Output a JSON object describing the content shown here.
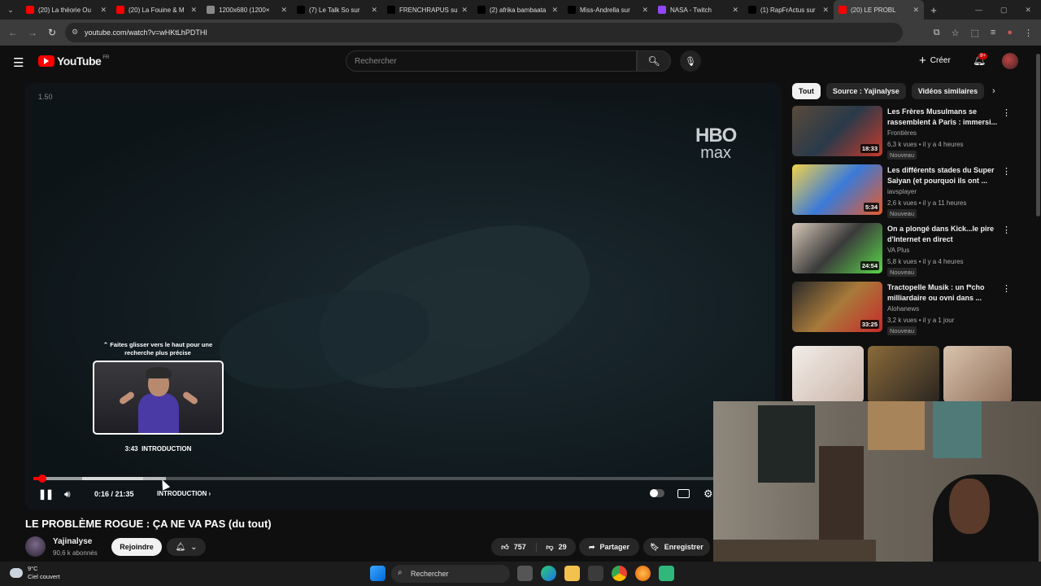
{
  "browser": {
    "tabs": [
      {
        "label": "(20) La théorie Ou",
        "color": "#ff0000"
      },
      {
        "label": "(20) La Fouine & M",
        "color": "#ff0000"
      },
      {
        "label": "1200x680 (1200×",
        "color": "#888888"
      },
      {
        "label": "(7) Le Talk So sur",
        "color": "#000000"
      },
      {
        "label": "FRENCHRAPUS sur",
        "color": "#000000"
      },
      {
        "label": "(2) afrika bambaata",
        "color": "#000000"
      },
      {
        "label": "Miss-Andrella sur",
        "color": "#000000"
      },
      {
        "label": "NASA - Twitch",
        "color": "#9146ff"
      },
      {
        "label": "(1) RapFrActus sur",
        "color": "#000000"
      },
      {
        "label": "(20) LE PROBL",
        "color": "#ff0000",
        "active": true
      }
    ],
    "url": "youtube.com/watch?v=wHKtLhPDTHI"
  },
  "youtube": {
    "logo_text": "YouTube",
    "country": "FR",
    "search_placeholder": "Rechercher",
    "create_label": "Créer",
    "notif_badge": "9+"
  },
  "player": {
    "speed": "1.50",
    "watermark_top": "HBO",
    "watermark_bottom": "max",
    "swipe_hint": "⌃ Faites glisser vers le haut pour une recherche plus précise",
    "preview_time": "3:43",
    "preview_chapter": "INTRODUCTION",
    "time_display": "0:16 / 21:35",
    "chapter": "INTRODUCTION",
    "progress_fraction": 0.012
  },
  "video": {
    "title": "LE PROBLÈME ROGUE : ÇA NE VA PAS (du tout)",
    "channel": "Yajinalyse",
    "subscribers": "90,6 k abonnés",
    "join_label": "Rejoindre",
    "likes": "757",
    "dislikes": "29",
    "share_label": "Partager",
    "save_label": "Enregistrer"
  },
  "sidebar": {
    "chips": [
      "Tout",
      "Source : Yajinalyse",
      "Vidéos similaires"
    ],
    "recommendations": [
      {
        "title": "Les Frères Musulmans se rassemblent à Paris : immersi...",
        "channel": "Frontières",
        "meta": "6,3 k vues • il y a 4 heures",
        "badge": "Nouveau",
        "duration": "18:33"
      },
      {
        "title": "Les différents stades du Super Saiyan (et pourquoi ils ont ...",
        "channel": "iavsplayer",
        "meta": "2,6 k vues • il y a 11 heures",
        "badge": "Nouveau",
        "duration": "5:34"
      },
      {
        "title": "On a plongé dans Kick...le pire d'Internet en direct",
        "channel": "VA Plus",
        "meta": "5,8 k vues • il y a 4 heures",
        "badge": "Nouveau",
        "duration": "24:54"
      },
      {
        "title": "Tractopelle Musik : un f*cho milliardaire ou ovni dans ...",
        "channel": "Alohanews",
        "meta": "3,2 k vues • il y a 1 jour",
        "badge": "Nouveau",
        "duration": "33:25"
      }
    ]
  },
  "taskbar": {
    "temperature": "9°C",
    "weather": "Ciel couvert",
    "search_label": "Rechercher"
  }
}
